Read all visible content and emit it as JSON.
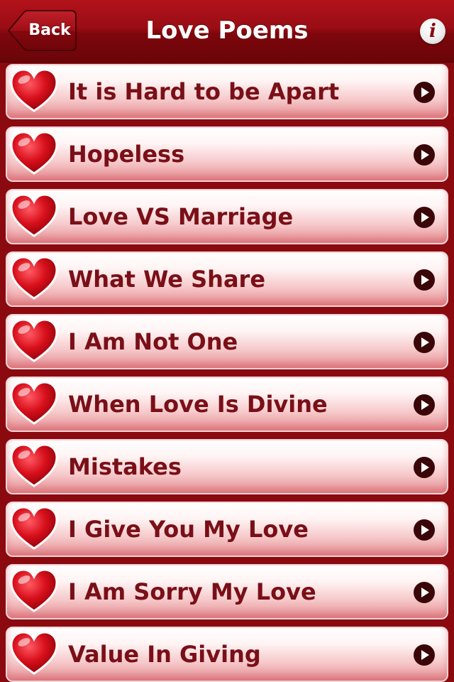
{
  "navbar": {
    "back_label": "Back",
    "title": "Love Poems",
    "info_glyph": "i"
  },
  "poems": [
    {
      "label": "It is Hard to be Apart"
    },
    {
      "label": "Hopeless"
    },
    {
      "label": "Love VS Marriage"
    },
    {
      "label": "What We Share"
    },
    {
      "label": "I Am Not One"
    },
    {
      "label": "When Love Is Divine"
    },
    {
      "label": "Mistakes"
    },
    {
      "label": "I Give You My Love"
    },
    {
      "label": "I Am Sorry My Love"
    },
    {
      "label": "Value In Giving"
    }
  ],
  "icons": {
    "row_icon": "heart-icon",
    "row_accessory": "chevron-right-circle-icon",
    "nav_info": "info-icon"
  },
  "colors": {
    "navbar": "#990d14",
    "background": "#8a0a10",
    "row_text": "#7a0f17",
    "heart": "#d8101c"
  }
}
